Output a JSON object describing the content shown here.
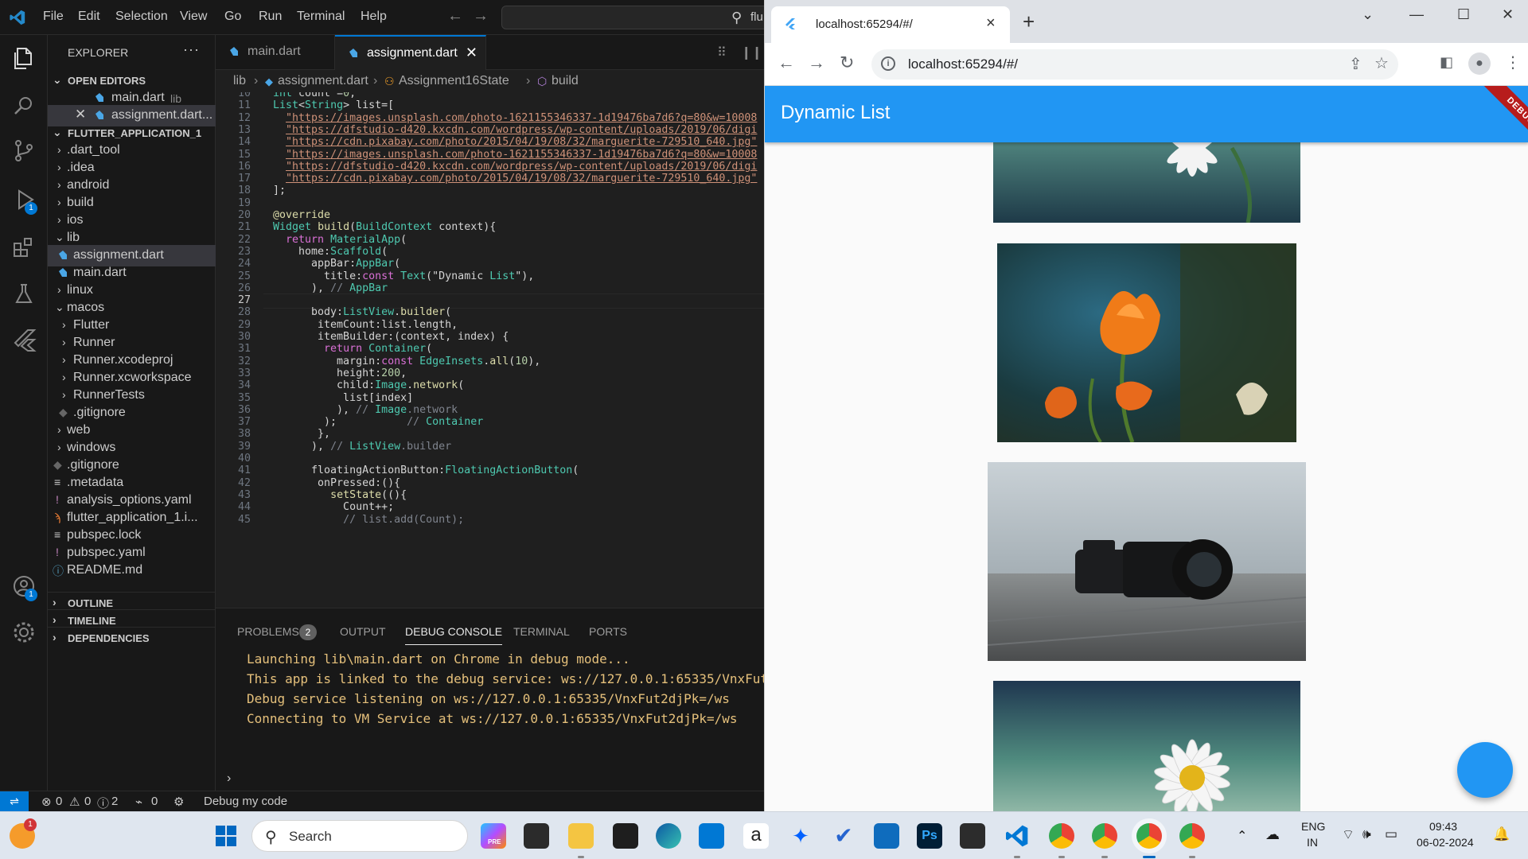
{
  "vscode": {
    "menu": [
      "File",
      "Edit",
      "Selection",
      "View",
      "Go",
      "Run",
      "Terminal",
      "Help"
    ],
    "command_center_text": "flu",
    "explorer_title": "EXPLORER",
    "open_editors_label": "OPEN EDITORS",
    "open_editors": [
      {
        "name": "main.dart",
        "path": "lib"
      },
      {
        "name": "assignment.dart..."
      }
    ],
    "project_label": "FLUTTER_APPLICATION_1",
    "tree": [
      ".dart_tool",
      ".idea",
      "android",
      "build",
      "ios",
      "lib",
      "assignment.dart",
      "main.dart",
      "linux",
      "macos",
      "Flutter",
      "Runner",
      "Runner.xcodeproj",
      "Runner.xcworkspace",
      "RunnerTests",
      ".gitignore",
      "web",
      "windows",
      ".gitignore",
      ".metadata",
      "analysis_options.yaml",
      "flutter_application_1.i...",
      "pubspec.lock",
      "pubspec.yaml",
      "README.md"
    ],
    "outline_label": "OUTLINE",
    "timeline_label": "TIMELINE",
    "dependencies_label": "DEPENDENCIES",
    "tabs": [
      "main.dart",
      "assignment.dart"
    ],
    "breadcrumb": [
      "lib",
      "assignment.dart",
      "Assignment16State",
      "build"
    ],
    "line_numbers": [
      "10",
      "11",
      "12",
      "13",
      "14",
      "15",
      "16",
      "17",
      "18",
      "19",
      "20",
      "21",
      "22",
      "23",
      "24",
      "25",
      "26",
      "27",
      "28",
      "29",
      "30",
      "31",
      "32",
      "33",
      "34",
      "35",
      "36",
      "37",
      "38",
      "39",
      "40",
      "41",
      "42",
      "43",
      "44",
      "45"
    ],
    "code_lines": [
      "int count =0;",
      "List<String> list=[",
      "  \"https://images.unsplash.com/photo-1621155346337-1d19476ba7d6?q=80&w=10008",
      "  \"https://dfstudio-d420.kxcdn.com/wordpress/wp-content/uploads/2019/06/digi",
      "  \"https://cdn.pixabay.com/photo/2015/04/19/08/32/marguerite-729510_640.jpg\"",
      "  \"https://images.unsplash.com/photo-1621155346337-1d19476ba7d6?q=80&w=10008",
      "  \"https://dfstudio-d420.kxcdn.com/wordpress/wp-content/uploads/2019/06/digi",
      "  \"https://cdn.pixabay.com/photo/2015/04/19/08/32/marguerite-729510_640.jpg\"",
      "];",
      "",
      "@override",
      "Widget build(BuildContext context){",
      "  return MaterialApp(",
      "    home:Scaffold(",
      "      appBar:AppBar(",
      "        title:const Text(\"Dynamic List\"),",
      "      ), // AppBar",
      "",
      "      body:ListView.builder(",
      "       itemCount:list.length,",
      "       itemBuilder:(context, index) {",
      "        return Container(",
      "          margin:const EdgeInsets.all(10),",
      "          height:200,",
      "          child:Image.network(",
      "           list[index]",
      "          ), // Image.network",
      "        );           // Container",
      "       },",
      "      ), // ListView.builder",
      "",
      "      floatingActionButton:FloatingActionButton(",
      "       onPressed:(){",
      "         setState((){",
      "           Count++;",
      "           // list.add(Count);"
    ],
    "panel_tabs": [
      "PROBLEMS",
      "OUTPUT",
      "DEBUG CONSOLE",
      "TERMINAL",
      "PORTS"
    ],
    "problems_count": "2",
    "console_lines": [
      "Launching lib\\main.dart on Chrome in debug mode...",
      "This app is linked to the debug service: ws://127.0.0.1:65335/VnxFut",
      "Debug service listening on ws://127.0.0.1:65335/VnxFut2djPk=/ws",
      "Connecting to VM Service at ws://127.0.0.1:65335/VnxFut2djPk=/ws"
    ],
    "status": {
      "errors": "0",
      "warnings": "0",
      "info": "2",
      "ports": "0",
      "debug_label": "Debug my code"
    },
    "activity_badges": {
      "run": "1",
      "accounts": "1"
    }
  },
  "chrome": {
    "tab_title": "localhost:65294/#/",
    "url": "localhost:65294/#/"
  },
  "flutter_app": {
    "title": "Dynamic List",
    "debug_banner": "DEBUG",
    "images": [
      "daisy",
      "tulips",
      "camera",
      "daisy"
    ]
  },
  "taskbar": {
    "search_label": "Search",
    "notification_badge": "1",
    "lang": "ENG",
    "region": "IN",
    "time": "09:43",
    "date": "06-02-2024",
    "pre_label": "PRE"
  },
  "colors": {
    "accent": "#0078d4",
    "appbar": "#2196f3",
    "console": "#e5c07b"
  }
}
